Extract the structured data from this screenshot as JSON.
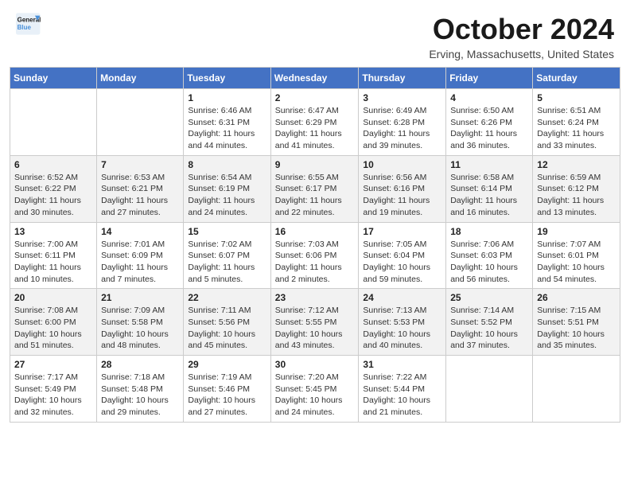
{
  "header": {
    "logo_line1": "General",
    "logo_line2": "Blue",
    "month": "October 2024",
    "location": "Erving, Massachusetts, United States"
  },
  "weekdays": [
    "Sunday",
    "Monday",
    "Tuesday",
    "Wednesday",
    "Thursday",
    "Friday",
    "Saturday"
  ],
  "weeks": [
    [
      {
        "day": "",
        "sunrise": "",
        "sunset": "",
        "daylight": ""
      },
      {
        "day": "",
        "sunrise": "",
        "sunset": "",
        "daylight": ""
      },
      {
        "day": "1",
        "sunrise": "Sunrise: 6:46 AM",
        "sunset": "Sunset: 6:31 PM",
        "daylight": "Daylight: 11 hours and 44 minutes."
      },
      {
        "day": "2",
        "sunrise": "Sunrise: 6:47 AM",
        "sunset": "Sunset: 6:29 PM",
        "daylight": "Daylight: 11 hours and 41 minutes."
      },
      {
        "day": "3",
        "sunrise": "Sunrise: 6:49 AM",
        "sunset": "Sunset: 6:28 PM",
        "daylight": "Daylight: 11 hours and 39 minutes."
      },
      {
        "day": "4",
        "sunrise": "Sunrise: 6:50 AM",
        "sunset": "Sunset: 6:26 PM",
        "daylight": "Daylight: 11 hours and 36 minutes."
      },
      {
        "day": "5",
        "sunrise": "Sunrise: 6:51 AM",
        "sunset": "Sunset: 6:24 PM",
        "daylight": "Daylight: 11 hours and 33 minutes."
      }
    ],
    [
      {
        "day": "6",
        "sunrise": "Sunrise: 6:52 AM",
        "sunset": "Sunset: 6:22 PM",
        "daylight": "Daylight: 11 hours and 30 minutes."
      },
      {
        "day": "7",
        "sunrise": "Sunrise: 6:53 AM",
        "sunset": "Sunset: 6:21 PM",
        "daylight": "Daylight: 11 hours and 27 minutes."
      },
      {
        "day": "8",
        "sunrise": "Sunrise: 6:54 AM",
        "sunset": "Sunset: 6:19 PM",
        "daylight": "Daylight: 11 hours and 24 minutes."
      },
      {
        "day": "9",
        "sunrise": "Sunrise: 6:55 AM",
        "sunset": "Sunset: 6:17 PM",
        "daylight": "Daylight: 11 hours and 22 minutes."
      },
      {
        "day": "10",
        "sunrise": "Sunrise: 6:56 AM",
        "sunset": "Sunset: 6:16 PM",
        "daylight": "Daylight: 11 hours and 19 minutes."
      },
      {
        "day": "11",
        "sunrise": "Sunrise: 6:58 AM",
        "sunset": "Sunset: 6:14 PM",
        "daylight": "Daylight: 11 hours and 16 minutes."
      },
      {
        "day": "12",
        "sunrise": "Sunrise: 6:59 AM",
        "sunset": "Sunset: 6:12 PM",
        "daylight": "Daylight: 11 hours and 13 minutes."
      }
    ],
    [
      {
        "day": "13",
        "sunrise": "Sunrise: 7:00 AM",
        "sunset": "Sunset: 6:11 PM",
        "daylight": "Daylight: 11 hours and 10 minutes."
      },
      {
        "day": "14",
        "sunrise": "Sunrise: 7:01 AM",
        "sunset": "Sunset: 6:09 PM",
        "daylight": "Daylight: 11 hours and 7 minutes."
      },
      {
        "day": "15",
        "sunrise": "Sunrise: 7:02 AM",
        "sunset": "Sunset: 6:07 PM",
        "daylight": "Daylight: 11 hours and 5 minutes."
      },
      {
        "day": "16",
        "sunrise": "Sunrise: 7:03 AM",
        "sunset": "Sunset: 6:06 PM",
        "daylight": "Daylight: 11 hours and 2 minutes."
      },
      {
        "day": "17",
        "sunrise": "Sunrise: 7:05 AM",
        "sunset": "Sunset: 6:04 PM",
        "daylight": "Daylight: 10 hours and 59 minutes."
      },
      {
        "day": "18",
        "sunrise": "Sunrise: 7:06 AM",
        "sunset": "Sunset: 6:03 PM",
        "daylight": "Daylight: 10 hours and 56 minutes."
      },
      {
        "day": "19",
        "sunrise": "Sunrise: 7:07 AM",
        "sunset": "Sunset: 6:01 PM",
        "daylight": "Daylight: 10 hours and 54 minutes."
      }
    ],
    [
      {
        "day": "20",
        "sunrise": "Sunrise: 7:08 AM",
        "sunset": "Sunset: 6:00 PM",
        "daylight": "Daylight: 10 hours and 51 minutes."
      },
      {
        "day": "21",
        "sunrise": "Sunrise: 7:09 AM",
        "sunset": "Sunset: 5:58 PM",
        "daylight": "Daylight: 10 hours and 48 minutes."
      },
      {
        "day": "22",
        "sunrise": "Sunrise: 7:11 AM",
        "sunset": "Sunset: 5:56 PM",
        "daylight": "Daylight: 10 hours and 45 minutes."
      },
      {
        "day": "23",
        "sunrise": "Sunrise: 7:12 AM",
        "sunset": "Sunset: 5:55 PM",
        "daylight": "Daylight: 10 hours and 43 minutes."
      },
      {
        "day": "24",
        "sunrise": "Sunrise: 7:13 AM",
        "sunset": "Sunset: 5:53 PM",
        "daylight": "Daylight: 10 hours and 40 minutes."
      },
      {
        "day": "25",
        "sunrise": "Sunrise: 7:14 AM",
        "sunset": "Sunset: 5:52 PM",
        "daylight": "Daylight: 10 hours and 37 minutes."
      },
      {
        "day": "26",
        "sunrise": "Sunrise: 7:15 AM",
        "sunset": "Sunset: 5:51 PM",
        "daylight": "Daylight: 10 hours and 35 minutes."
      }
    ],
    [
      {
        "day": "27",
        "sunrise": "Sunrise: 7:17 AM",
        "sunset": "Sunset: 5:49 PM",
        "daylight": "Daylight: 10 hours and 32 minutes."
      },
      {
        "day": "28",
        "sunrise": "Sunrise: 7:18 AM",
        "sunset": "Sunset: 5:48 PM",
        "daylight": "Daylight: 10 hours and 29 minutes."
      },
      {
        "day": "29",
        "sunrise": "Sunrise: 7:19 AM",
        "sunset": "Sunset: 5:46 PM",
        "daylight": "Daylight: 10 hours and 27 minutes."
      },
      {
        "day": "30",
        "sunrise": "Sunrise: 7:20 AM",
        "sunset": "Sunset: 5:45 PM",
        "daylight": "Daylight: 10 hours and 24 minutes."
      },
      {
        "day": "31",
        "sunrise": "Sunrise: 7:22 AM",
        "sunset": "Sunset: 5:44 PM",
        "daylight": "Daylight: 10 hours and 21 minutes."
      },
      {
        "day": "",
        "sunrise": "",
        "sunset": "",
        "daylight": ""
      },
      {
        "day": "",
        "sunrise": "",
        "sunset": "",
        "daylight": ""
      }
    ]
  ]
}
